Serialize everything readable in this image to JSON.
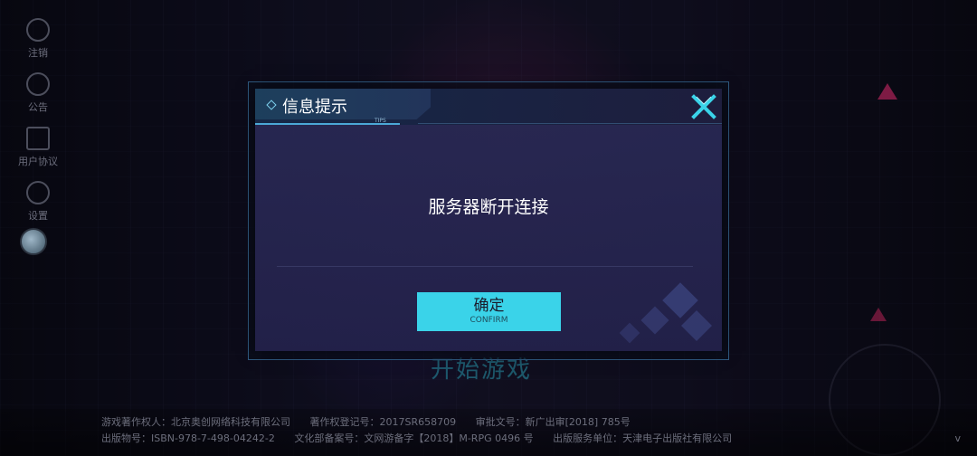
{
  "side_menu": [
    {
      "label": "注销",
      "icon": "user-icon"
    },
    {
      "label": "公告",
      "icon": "megaphone-icon"
    },
    {
      "label": "用户协议",
      "icon": "document-icon"
    },
    {
      "label": "设置",
      "icon": "gear-icon"
    }
  ],
  "background": {
    "start_game_label": "开始游戏"
  },
  "dialog": {
    "title": "信息提示",
    "tips_label": "TIPS",
    "message": "服务器断开连接",
    "confirm_label": "确定",
    "confirm_sub": "CONFIRM",
    "accent_color": "#3ad3e9"
  },
  "footer": {
    "line1": [
      "游戏著作权人：北京奥创网络科技有限公司",
      "著作权登记号：2017SR658709",
      "审批文号：新广出审[2018] 785号"
    ],
    "line2": [
      "出版物号：ISBN-978-7-498-04242-2",
      "文化部备案号：文网游备字【2018】M-RPG 0496 号",
      "出版服务单位：天津电子出版社有限公司"
    ],
    "version_mark": "v"
  }
}
